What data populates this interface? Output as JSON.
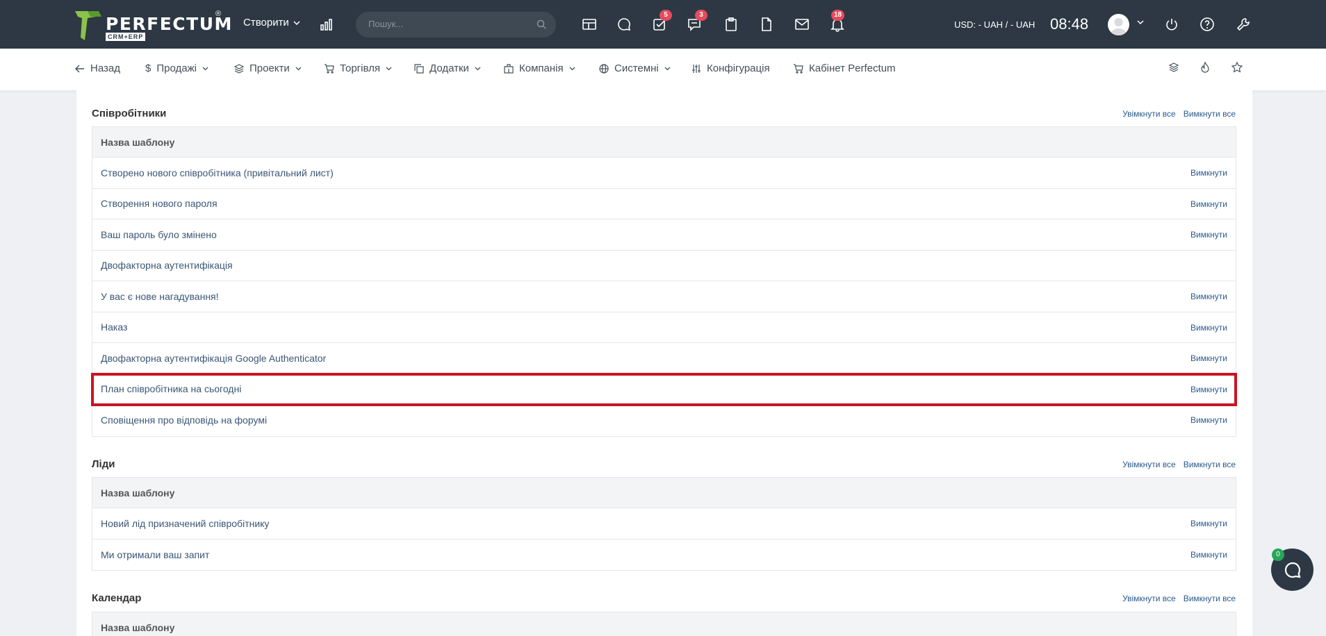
{
  "header": {
    "logo_text": "PERFECTUM",
    "logo_reg": "®",
    "logo_sub": "CRM+ERP",
    "create_label": "Створити",
    "search_placeholder": "Пошук...",
    "badges": {
      "tasks": "5",
      "chat": "3",
      "notifications": "18"
    },
    "currency": "USD: - UAH / - UAH",
    "time": "08:48"
  },
  "nav": {
    "back": "Назад",
    "sales": "Продажі",
    "projects": "Проекти",
    "trade": "Торгівля",
    "addons": "Додатки",
    "company": "Компанія",
    "system": "Системні",
    "config": "Конфігурація",
    "cabinet": "Кабінет Perfectum"
  },
  "sections": {
    "employees": {
      "title": "Співробітники",
      "enable_all": "Увімкнути все",
      "disable_all": "Вимкнути все",
      "header": "Назва шаблону",
      "rows": [
        {
          "name": "Створено нового співробітника (привітальний лист)",
          "action": "Вимкнути"
        },
        {
          "name": "Створення нового пароля",
          "action": "Вимкнути"
        },
        {
          "name": "Ваш пароль було змінено",
          "action": "Вимкнути"
        },
        {
          "name": "Двофакторна аутентифікація",
          "action": ""
        },
        {
          "name": "У вас є нове нагадування!",
          "action": "Вимкнути"
        },
        {
          "name": "Наказ",
          "action": "Вимкнути"
        },
        {
          "name": "Двофакторна аутентифікація Google Authenticator",
          "action": "Вимкнути"
        },
        {
          "name": "План співробітника на сьогодні",
          "action": "Вимкнути"
        },
        {
          "name": "Сповіщення про відповідь на форумі",
          "action": "Вимкнути"
        }
      ]
    },
    "leads": {
      "title": "Ліди",
      "enable_all": "Увімкнути все",
      "disable_all": "Вимкнути все",
      "header": "Назва шаблону",
      "rows": [
        {
          "name": "Новий лід призначений співробітнику",
          "action": "Вимкнути"
        },
        {
          "name": "Ми отримали ваш запит",
          "action": "Вимкнути"
        }
      ]
    },
    "calendar": {
      "title": "Календар",
      "enable_all": "Увімкнути все",
      "disable_all": "Вимкнути все",
      "header": "Назва шаблону"
    }
  },
  "chat": {
    "badge": "0"
  },
  "colors": {
    "topbar": "#2d3844",
    "accent_link": "#2a5a8c",
    "badge": "#e64a5c",
    "highlight": "#cc1420",
    "logo_green": "#8bc34a"
  }
}
